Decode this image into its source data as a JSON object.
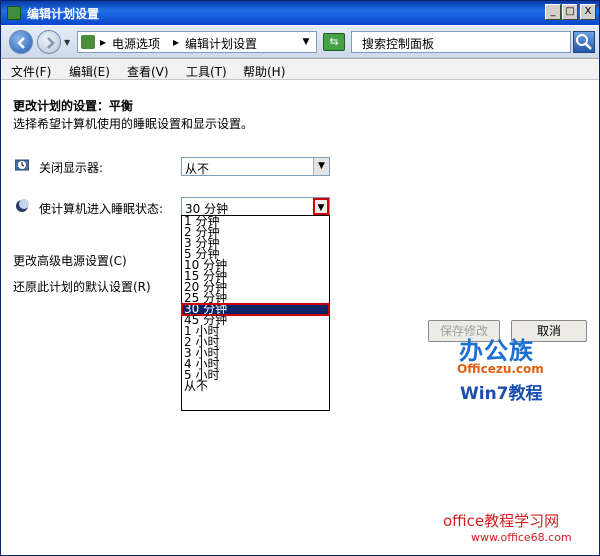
{
  "window": {
    "title": "编辑计划设置",
    "controls": {
      "minimize": "_",
      "maximize": "□",
      "close": "X"
    }
  },
  "address": {
    "crumbs": [
      "电源选项",
      "编辑计划设置"
    ],
    "separator": "▸",
    "search_placeholder": "搜索控制面板"
  },
  "menu": [
    "文件(F)",
    "编辑(E)",
    "查看(V)",
    "工具(T)",
    "帮助(H)"
  ],
  "content": {
    "heading": "更改计划的设置：平衡",
    "subtext": "选择希望计算机使用的睡眠设置和显示设置。",
    "display_label": "关闭显示器:",
    "display_value": "从不",
    "sleep_label": "使计算机进入睡眠状态:",
    "sleep_value": "30 分钟",
    "advanced_link": "更改高级电源设置(C)",
    "restore_link": "还原此计划的默认设置(R)",
    "save_button": "保存修改",
    "cancel_button": "取消"
  },
  "sleep_options": [
    "1 分钟",
    "2 分钟",
    "3 分钟",
    "5 分钟",
    "10 分钟",
    "15 分钟",
    "20 分钟",
    "25 分钟",
    "30 分钟",
    "45 分钟",
    "1 小时",
    "2 小时",
    "3 小时",
    "4 小时",
    "5 小时",
    "从不"
  ],
  "sleep_selected_index": 8,
  "watermarks": {
    "logo": "办公族",
    "site": "Officezu.com",
    "win7": "Win7教程",
    "bottom_title": "office教程学习网",
    "bottom_url": "www.office68.com"
  },
  "colors": {
    "selection": "#0a246a",
    "highlight_border": "#d00000"
  }
}
